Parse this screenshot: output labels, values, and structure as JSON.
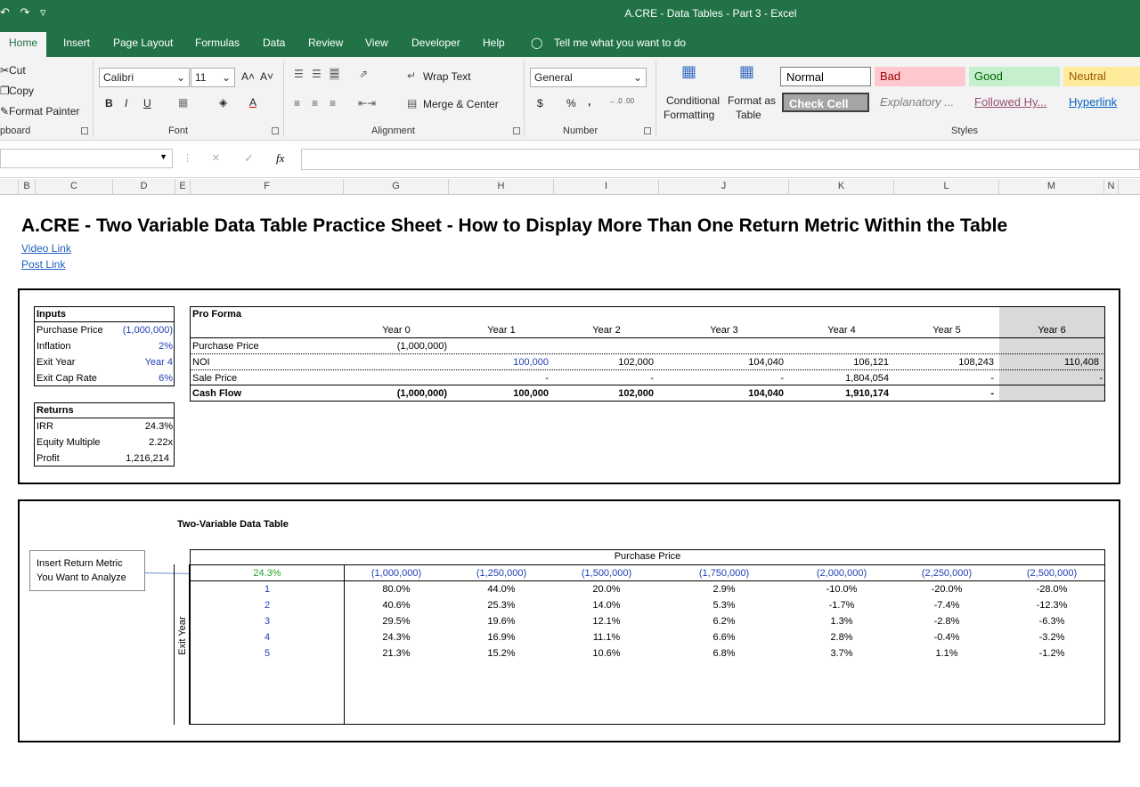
{
  "window": {
    "title": "A.CRE - Data Tables - Part 3  -  Excel",
    "quick_access": "↶ ↷ ▿"
  },
  "tabs": [
    "Home",
    "Insert",
    "Page Layout",
    "Formulas",
    "Data",
    "Review",
    "View",
    "Developer",
    "Help"
  ],
  "tell_me": "Tell me what you want to do",
  "ribbon": {
    "clipboard": {
      "cut": "Cut",
      "copy": "Copy",
      "format_painter": "Format Painter",
      "label": "pboard"
    },
    "font": {
      "name": "Calibri",
      "size": "11",
      "label": "Font",
      "grow": "A˄",
      "shrink": "A˅",
      "bold": "B",
      "italic": "I",
      "underline": "U"
    },
    "alignment": {
      "wrap_text": "Wrap Text",
      "merge_center": "Merge & Center",
      "label": "Alignment"
    },
    "number": {
      "format": "General",
      "currency": "$",
      "percent": "%",
      "comma": ",",
      "label": "Number",
      "inc_dec": "←.0 .00",
      "dec_dec": ".00 →.0"
    },
    "styles": {
      "conditional_formatting": [
        "Conditional",
        "Formatting"
      ],
      "format_as_table": [
        "Format as",
        "Table"
      ],
      "normal": "Normal",
      "bad": "Bad",
      "good": "Good",
      "neutral": "Neutral",
      "check_cell": "Check Cell",
      "explanatory": "Explanatory ...",
      "followed": "Followed Hy...",
      "hyperlink": "Hyperlink",
      "label": "Styles"
    }
  },
  "formula_bar": {
    "fx": "fx",
    "cancel": "×",
    "enter": "✓",
    "value": ""
  },
  "columns": [
    "B",
    "C",
    "D",
    "E",
    "F",
    "G",
    "H",
    "I",
    "J",
    "K",
    "L",
    "M",
    "N"
  ],
  "sheet": {
    "title": "A.CRE - Two Variable Data Table Practice Sheet - How to Display More Than One Return Metric Within the Table",
    "video_link": "Video Link",
    "post_link": "Post Link",
    "inputs": {
      "header": "Inputs",
      "rows": [
        {
          "label": "Purchase Price",
          "value": "(1,000,000)"
        },
        {
          "label": "Inflation",
          "value": "2%"
        },
        {
          "label": "Exit Year",
          "value": "Year 4"
        },
        {
          "label": "Exit Cap Rate",
          "value": "6%"
        }
      ]
    },
    "returns": {
      "header": "Returns",
      "rows": [
        {
          "label": "IRR",
          "value": "24.3%"
        },
        {
          "label": "Equity Multiple",
          "value": "2.22x"
        },
        {
          "label": "Profit",
          "value": "1,216,214"
        }
      ]
    },
    "proforma": {
      "header": "Pro Forma",
      "years": [
        "Year 0",
        "Year 1",
        "Year 2",
        "Year 3",
        "Year 4",
        "Year 5",
        "Year 6"
      ],
      "rows": [
        {
          "label": "Purchase Price",
          "values": [
            "(1,000,000)",
            "",
            "",
            "",
            "",
            "",
            ""
          ]
        },
        {
          "label": "NOI",
          "values": [
            "",
            "100,000",
            "102,000",
            "104,040",
            "106,121",
            "108,243",
            "110,408"
          ]
        },
        {
          "label": "Sale Price",
          "values": [
            "",
            "-",
            "-",
            "-",
            "1,804,054",
            "-",
            "-"
          ]
        },
        {
          "label": "Cash Flow",
          "values": [
            "(1,000,000)",
            "100,000",
            "102,000",
            "104,040",
            "1,910,174",
            "-",
            ""
          ]
        }
      ]
    },
    "data_table": {
      "title": "Two-Variable Data Table",
      "col_var": "Purchase Price",
      "row_var": "Exit Year",
      "corner": "24.3%",
      "callout": [
        "Insert Return Metric",
        "You Want to Analyze"
      ],
      "col_headers": [
        "(1,000,000)",
        "(1,250,000)",
        "(1,500,000)",
        "(1,750,000)",
        "(2,000,000)",
        "(2,250,000)",
        "(2,500,000)"
      ],
      "rows": [
        {
          "year": "1",
          "values": [
            "80.0%",
            "44.0%",
            "20.0%",
            "2.9%",
            "-10.0%",
            "-20.0%",
            "-28.0%"
          ]
        },
        {
          "year": "2",
          "values": [
            "40.6%",
            "25.3%",
            "14.0%",
            "5.3%",
            "-1.7%",
            "-7.4%",
            "-12.3%"
          ]
        },
        {
          "year": "3",
          "values": [
            "29.5%",
            "19.6%",
            "12.1%",
            "6.2%",
            "1.3%",
            "-2.8%",
            "-6.3%"
          ]
        },
        {
          "year": "4",
          "values": [
            "24.3%",
            "16.9%",
            "11.1%",
            "6.6%",
            "2.8%",
            "-0.4%",
            "-3.2%"
          ]
        },
        {
          "year": "5",
          "values": [
            "21.3%",
            "15.2%",
            "10.6%",
            "6.8%",
            "3.7%",
            "1.1%",
            "-1.2%"
          ]
        }
      ]
    }
  }
}
